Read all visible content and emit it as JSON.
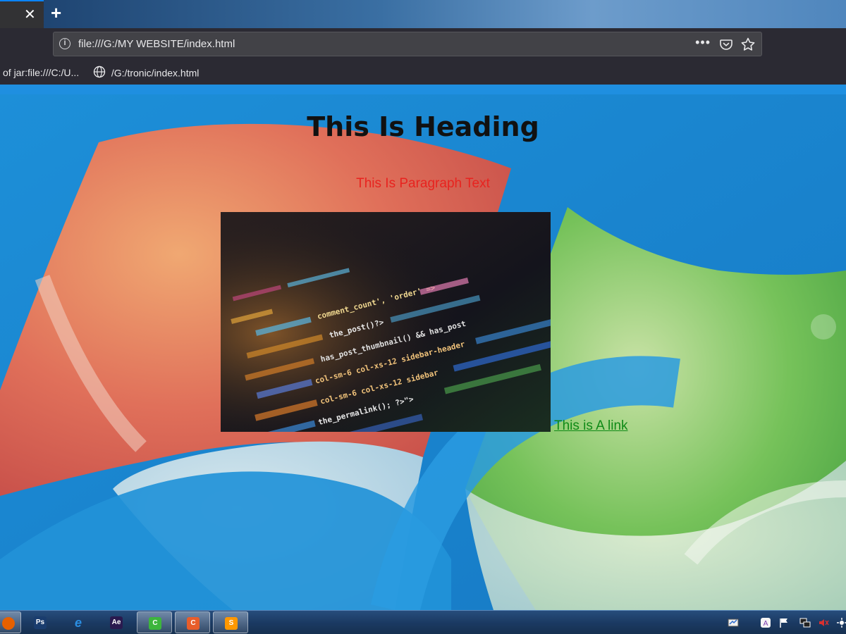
{
  "browser": {
    "tab_close_glyph": "✕",
    "new_tab_glyph": "+",
    "info_glyph": "i",
    "url": "file:///G:/MY WEBSITE/index.html",
    "more_glyph": "•••",
    "bookmarks": [
      {
        "label": "of jar:file:///C:/U..."
      },
      {
        "label": "/G:/tronic/index.html"
      }
    ]
  },
  "page": {
    "heading": "This Is Heading",
    "paragraph": "This Is Paragraph Text",
    "link_text": "This is A link",
    "image_code_fragments": [
      "comment_count', 'order' =>",
      "the_post()?>",
      "has_post_thumbnail() && has_post",
      "col-sm-6 col-xs-12 sidebar-header",
      "col-sm-6 col-xs-12 sidebar",
      "the_permalink(); ?>\">"
    ]
  },
  "taskbar": {
    "apps": [
      {
        "name": "firefox",
        "label": "",
        "color": "#e66000",
        "active": true
      },
      {
        "name": "photoshop",
        "label": "Ps",
        "color": "#1a3d6e",
        "active": false
      },
      {
        "name": "internet-explorer",
        "label": "e",
        "color": "#2b8fe3",
        "active": false
      },
      {
        "name": "after-effects",
        "label": "Ae",
        "color": "#2a1a4f",
        "active": false
      },
      {
        "name": "camtasia-green",
        "label": "C",
        "color": "#3db53d",
        "active": true
      },
      {
        "name": "camtasia-orange",
        "label": "C",
        "color": "#e85d2a",
        "active": true
      },
      {
        "name": "sublime-text",
        "label": "S",
        "color": "#ff9800",
        "active": true
      }
    ]
  },
  "colors": {
    "heading": "#111111",
    "paragraph": "#e8231f",
    "link": "#0f8a16",
    "chrome": "#2b2a33"
  }
}
